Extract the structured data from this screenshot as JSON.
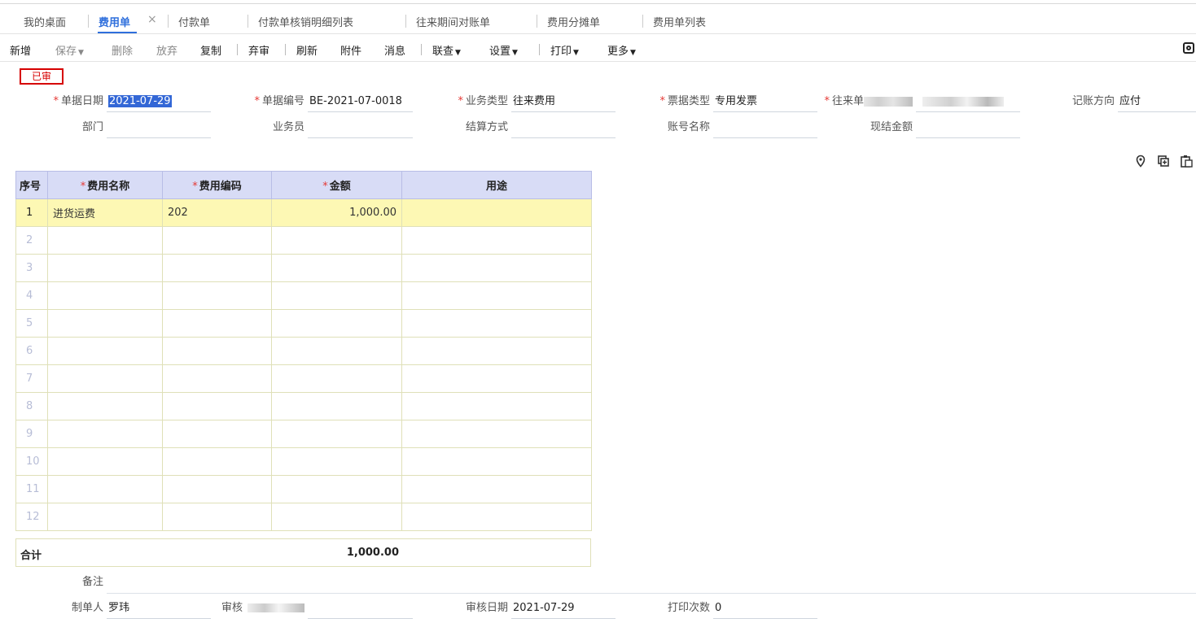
{
  "tabs": [
    {
      "label": "我的桌面"
    },
    {
      "label": "费用单"
    },
    {
      "label": "付款单"
    },
    {
      "label": "付款单核销明细列表"
    },
    {
      "label": "往来期间对账单"
    },
    {
      "label": "费用分摊单"
    },
    {
      "label": "费用单列表"
    }
  ],
  "tab_close_glyph": "×",
  "toolbar": {
    "new": "新增",
    "save": "保存",
    "delete": "删除",
    "abandon": "放弃",
    "copy": "复制",
    "unaudit": "弃审",
    "refresh": "刷新",
    "attachment": "附件",
    "message": "消息",
    "link": "联查",
    "settings": "设置",
    "print": "打印",
    "more": "更多"
  },
  "status_badge": "已审",
  "form": {
    "doc_date": {
      "label": "单据日期",
      "value": "2021-07-29"
    },
    "doc_no": {
      "label": "单据编号",
      "value": "BE-2021-07-0018"
    },
    "biz_type": {
      "label": "业务类型",
      "value": "往来费用"
    },
    "invoice_type": {
      "label": "票据类型",
      "value": "专用发票"
    },
    "counterparty": {
      "label": "往来单",
      "value": ""
    },
    "direction": {
      "label": "记账方向",
      "value": "应付"
    },
    "department": {
      "label": "部门",
      "value": ""
    },
    "salesman": {
      "label": "业务员",
      "value": ""
    },
    "settlement": {
      "label": "结算方式",
      "value": ""
    },
    "account_name": {
      "label": "账号名称",
      "value": ""
    },
    "cash_amount": {
      "label": "现结金额",
      "value": ""
    }
  },
  "grid": {
    "headers": {
      "idx": "序号",
      "fee_name": "费用名称",
      "fee_code": "费用编码",
      "amount": "金额",
      "purpose": "用途"
    },
    "rows": [
      {
        "idx": "1",
        "fee_name": "进货运费",
        "fee_code": "202",
        "amount": "1,000.00",
        "purpose": ""
      },
      {
        "idx": "2",
        "fee_name": "",
        "fee_code": "",
        "amount": "",
        "purpose": ""
      },
      {
        "idx": "3",
        "fee_name": "",
        "fee_code": "",
        "amount": "",
        "purpose": ""
      },
      {
        "idx": "4",
        "fee_name": "",
        "fee_code": "",
        "amount": "",
        "purpose": ""
      },
      {
        "idx": "5",
        "fee_name": "",
        "fee_code": "",
        "amount": "",
        "purpose": ""
      },
      {
        "idx": "6",
        "fee_name": "",
        "fee_code": "",
        "amount": "",
        "purpose": ""
      },
      {
        "idx": "7",
        "fee_name": "",
        "fee_code": "",
        "amount": "",
        "purpose": ""
      },
      {
        "idx": "8",
        "fee_name": "",
        "fee_code": "",
        "amount": "",
        "purpose": ""
      },
      {
        "idx": "9",
        "fee_name": "",
        "fee_code": "",
        "amount": "",
        "purpose": ""
      },
      {
        "idx": "10",
        "fee_name": "",
        "fee_code": "",
        "amount": "",
        "purpose": ""
      },
      {
        "idx": "11",
        "fee_name": "",
        "fee_code": "",
        "amount": "",
        "purpose": ""
      },
      {
        "idx": "12",
        "fee_name": "",
        "fee_code": "",
        "amount": "",
        "purpose": ""
      }
    ],
    "total_label": "合计",
    "total_amount": "1,000.00"
  },
  "footer": {
    "remark": {
      "label": "备注",
      "value": ""
    },
    "creator": {
      "label": "制单人",
      "value": "罗玮"
    },
    "auditor": {
      "label": "审核",
      "value": ""
    },
    "audit_date": {
      "label": "审核日期",
      "value": "2021-07-29"
    },
    "print_count": {
      "label": "打印次数",
      "value": "0"
    }
  },
  "icons": [
    "location-icon",
    "copy-doc-icon",
    "paste-doc-icon",
    "camera-icon"
  ],
  "colors": {
    "accent": "#2f6fdc",
    "status_red": "#d60000",
    "header_bg": "#d8dcf6",
    "selected_row": "#fdf8b4"
  }
}
